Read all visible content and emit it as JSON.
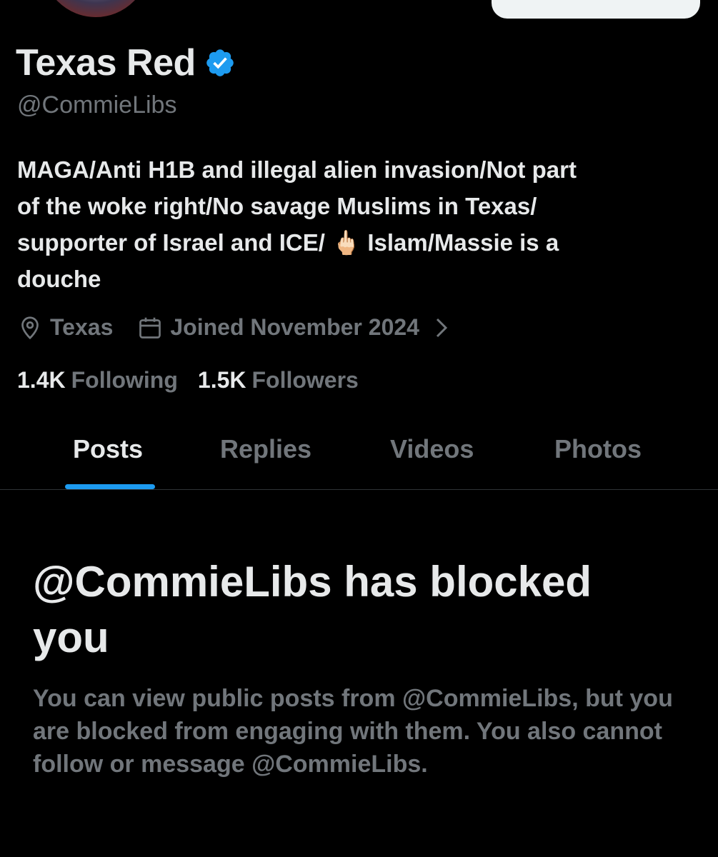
{
  "profile": {
    "display_name": "Texas Red",
    "handle": "@CommieLibs",
    "bio_lines": [
      "MAGA/Anti H1B and illegal alien invasion/Not part",
      "of the woke right/No savage Muslims in Texas/",
      "supporter of Israel and ICE/ 🖕🏻 Islam/Massie is a",
      "douche"
    ],
    "location": "Texas",
    "joined": "Joined November 2024",
    "following_count": "1.4K",
    "following_label": "Following",
    "followers_count": "1.5K",
    "followers_label": "Followers"
  },
  "tabs": [
    {
      "label": "Posts",
      "active": true
    },
    {
      "label": "Replies",
      "active": false
    },
    {
      "label": "Videos",
      "active": false
    },
    {
      "label": "Photos",
      "active": false
    }
  ],
  "blocked": {
    "title": "@CommieLibs has blocked you",
    "message": "You can view public posts from @CommieLibs, but you are blocked from engaging with them. You also cannot follow or message @CommieLibs."
  },
  "icons": {
    "verified": "verified-badge-icon",
    "location": "location-pin-icon",
    "calendar": "calendar-icon",
    "chevron": "chevron-right-icon"
  },
  "colors": {
    "background": "#000000",
    "primary_text": "#e7e9ea",
    "secondary_text": "#71767b",
    "accent": "#1d9bf0",
    "divider": "#2f3336"
  }
}
